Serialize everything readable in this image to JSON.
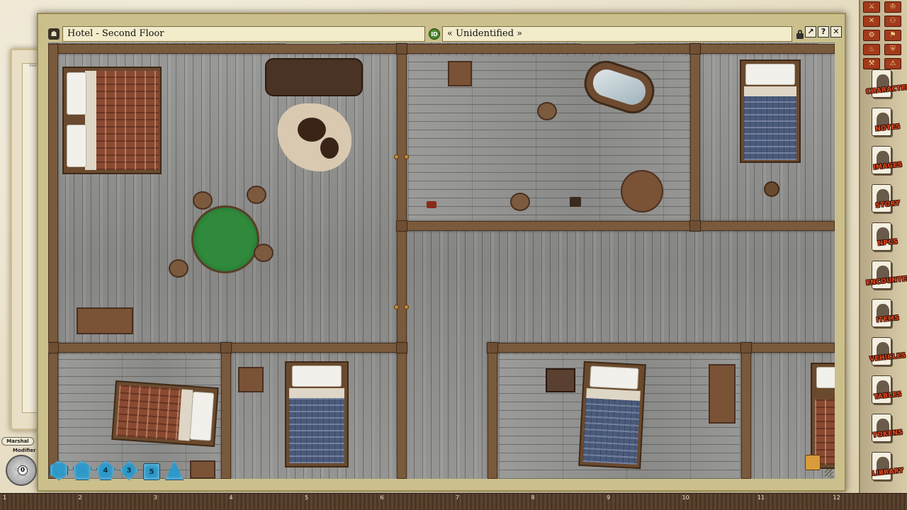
{
  "window": {
    "title": "Hotel - Second Floor",
    "identity": "« Unidentified »",
    "btn_share": "↗",
    "btn_help": "?",
    "btn_close": "✕"
  },
  "background_window": {
    "label": "Valu"
  },
  "dice": [
    {
      "type": "d20",
      "label": ""
    },
    {
      "type": "d12",
      "label": ""
    },
    {
      "type": "d10",
      "label": "4"
    },
    {
      "type": "d8",
      "label": "3"
    },
    {
      "type": "d6",
      "label": "5"
    },
    {
      "type": "d4",
      "label": ""
    }
  ],
  "modifier": {
    "player": "Marshal",
    "label": "Modifier",
    "value": "0"
  },
  "sidebar": {
    "tools": [
      "⚔",
      "♔",
      "✕",
      "⚇",
      "⚙",
      "⚑",
      "♨",
      "⛨",
      "⚒",
      "⚠",
      "☼"
    ],
    "library": [
      {
        "label": "CHARACTERS",
        "name": "characters"
      },
      {
        "label": "NOTES",
        "name": "notes"
      },
      {
        "label": "IMAGES",
        "name": "images"
      },
      {
        "label": "STORY",
        "name": "story"
      },
      {
        "label": "NPCS",
        "name": "npcs"
      },
      {
        "label": "ENCOUNTERS",
        "name": "encounters"
      },
      {
        "label": "ITEMS",
        "name": "items"
      },
      {
        "label": "VEHICLES",
        "name": "vehicles"
      },
      {
        "label": "TABLES",
        "name": "tables"
      },
      {
        "label": "TOKENS",
        "name": "tokens"
      },
      {
        "label": "LIBRARY",
        "name": "library"
      }
    ]
  },
  "ruler": [
    "1",
    "2",
    "3",
    "4",
    "5",
    "6",
    "7",
    "8",
    "9",
    "10",
    "11",
    "12"
  ],
  "colors": {
    "frame": "#cbbf8c",
    "die": "#2e98c8",
    "library_label": "#e0481e"
  }
}
